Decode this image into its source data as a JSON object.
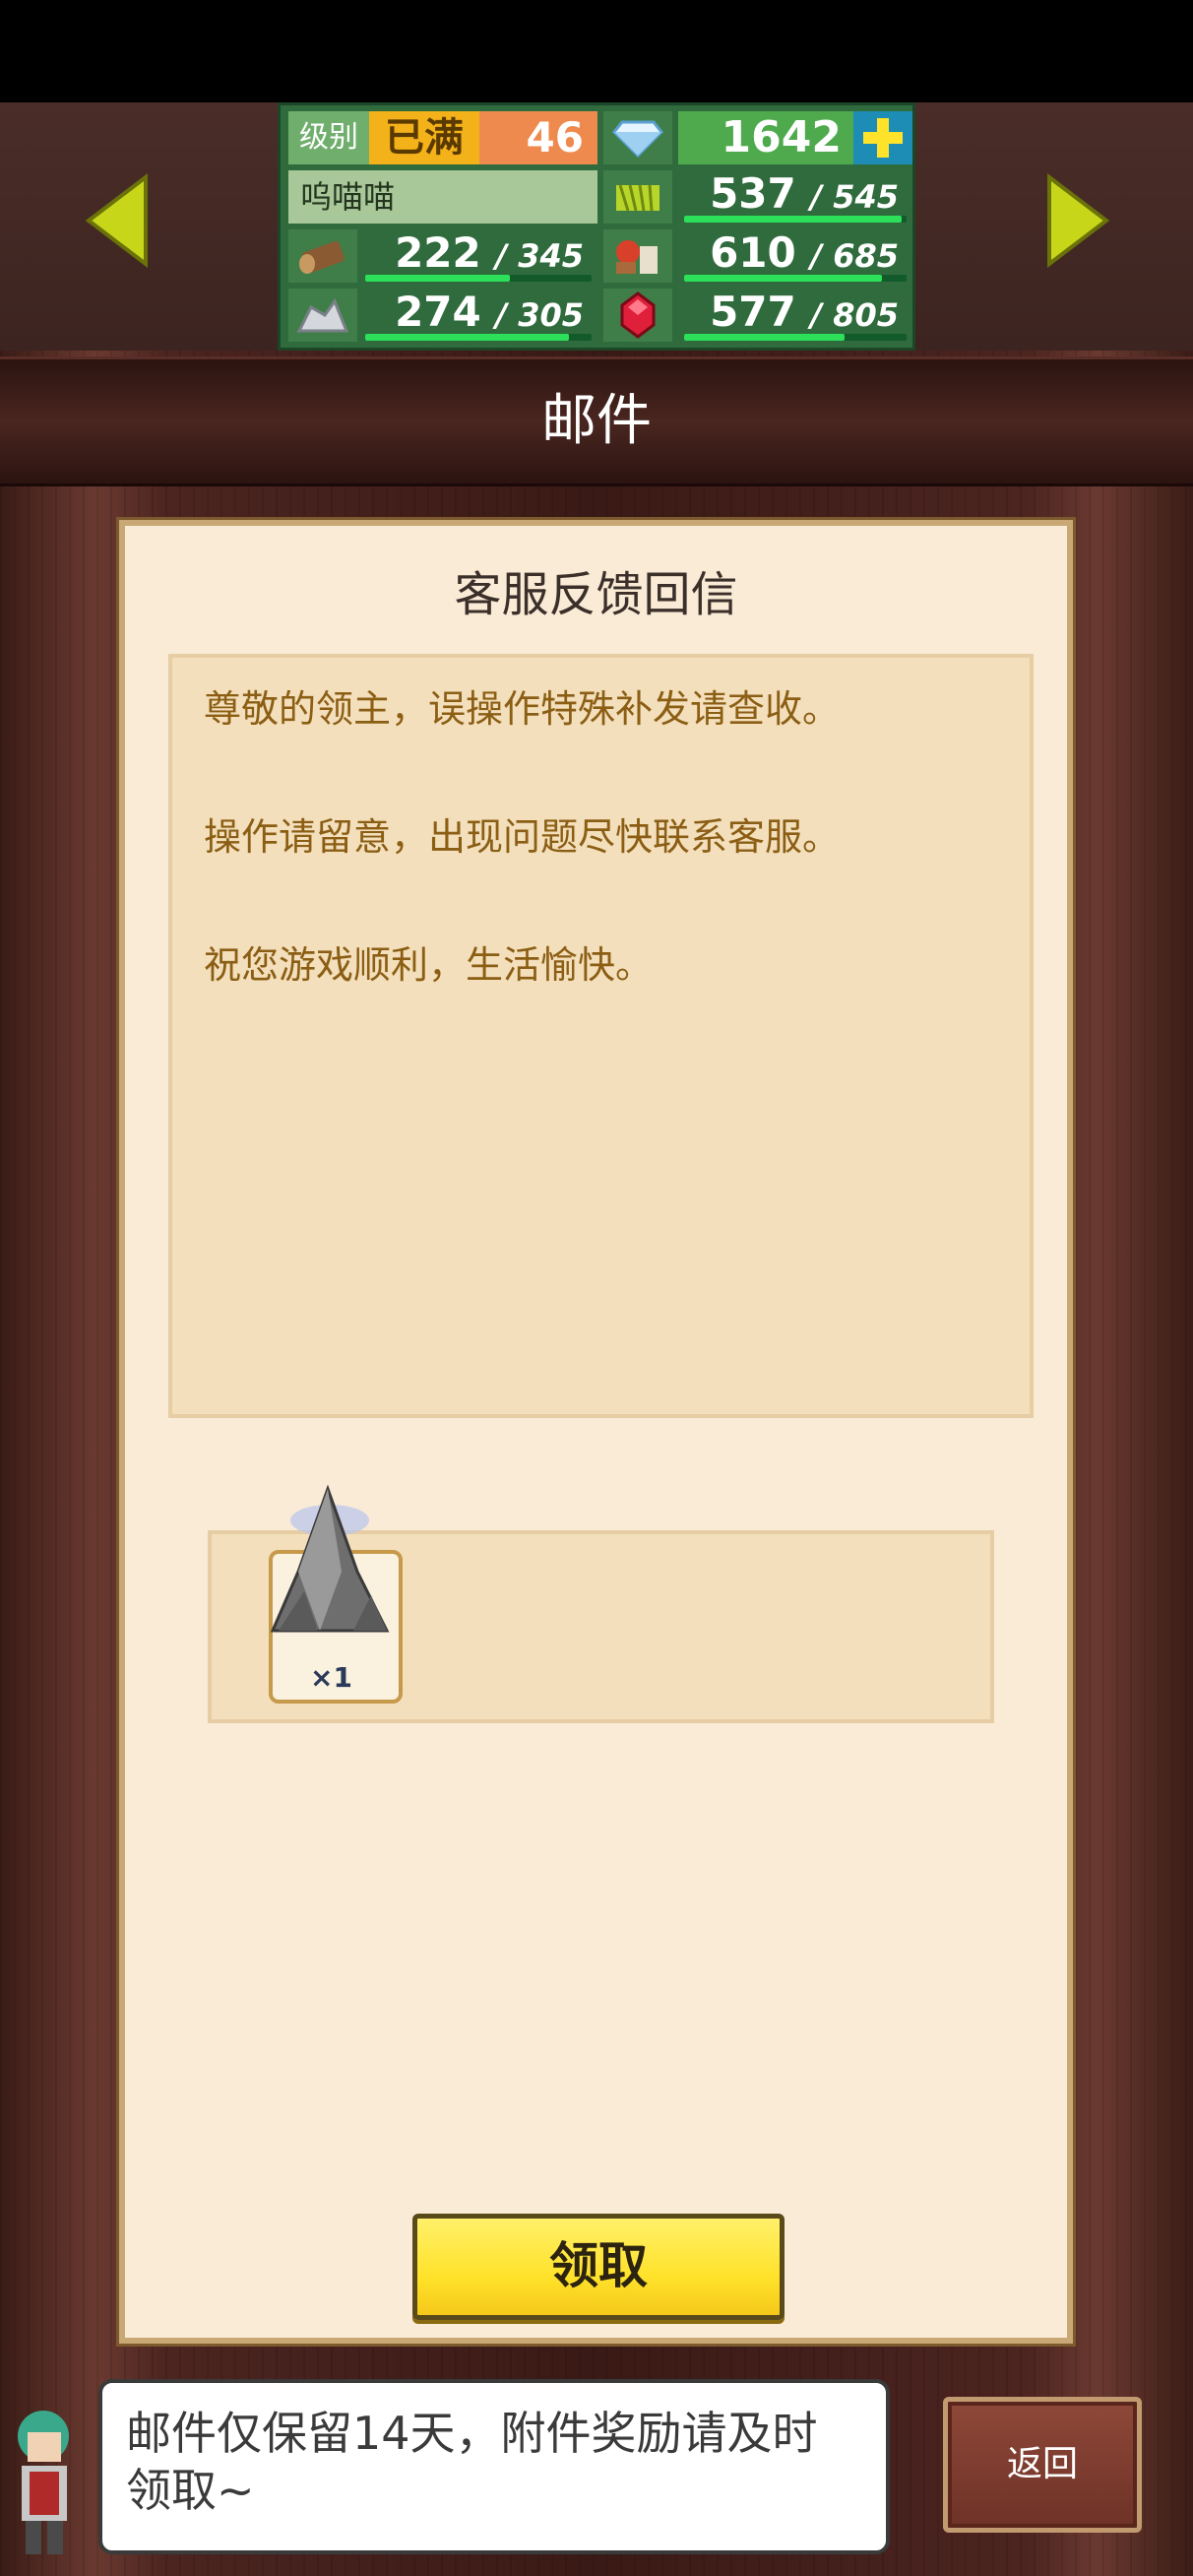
{
  "resources": {
    "level_label": "级别",
    "level_max": "已满",
    "level_value": "46",
    "gem_value": "1642",
    "player_name": "呜喵喵",
    "wood": {
      "value": "222",
      "cap": "345",
      "fill": 0.64
    },
    "stone": {
      "value": "274",
      "cap": "305",
      "fill": 0.9
    },
    "grain": {
      "value": "537",
      "cap": "545",
      "fill": 0.98
    },
    "food": {
      "value": "610",
      "cap": "685",
      "fill": 0.89
    },
    "ruby": {
      "value": "577",
      "cap": "805",
      "fill": 0.72
    }
  },
  "title": "邮件",
  "mail": {
    "subject": "客服反馈回信",
    "lines": [
      "尊敬的领主，误操作特殊补发请查收。",
      "操作请留意，出现问题尽快联系客服。",
      "祝您游戏顺利，生活愉快。"
    ],
    "attachment": {
      "icon": "rock-pile-icon",
      "quantity": "×1"
    },
    "claim_label": "领取"
  },
  "tip": "邮件仅保留14天，附件奖励请及时领取~",
  "back_label": "返回",
  "colors": {
    "claim": "#ffe22a",
    "panel": "#faebd6",
    "resource_bar": "#2ce05a"
  }
}
